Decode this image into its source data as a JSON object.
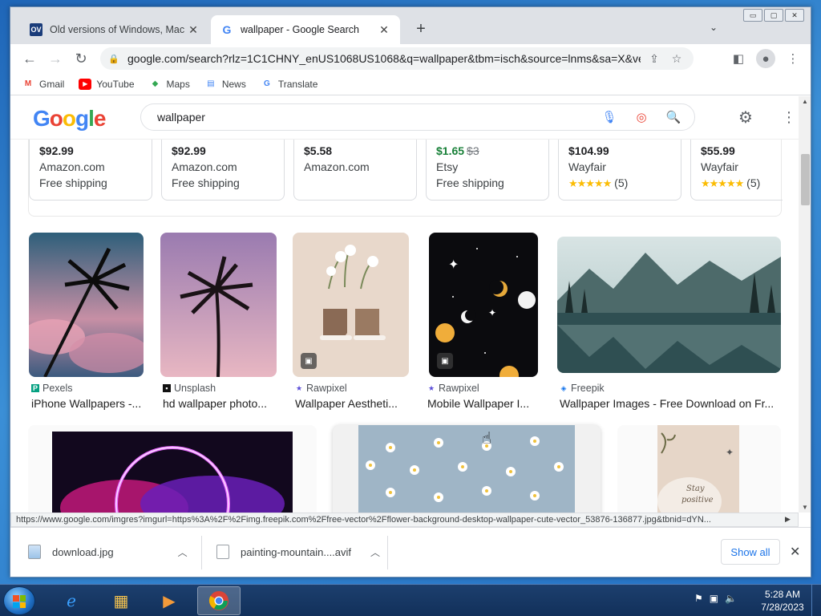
{
  "window": {
    "tabs": [
      {
        "title": "Old versions of Windows, Mac and",
        "favicon": "OV"
      },
      {
        "title": "wallpaper - Google Search",
        "favicon": "G"
      }
    ],
    "new_tab": "+",
    "controls": {
      "minimize": "▭",
      "maximize": "▢",
      "close": "✕"
    }
  },
  "toolbar": {
    "url": "google.com/search?rlz=1C1CHNY_enUS1068US1068&q=wallpaper&tbm=isch&source=lnms&sa=X&ved=2..."
  },
  "bookmarks": [
    {
      "label": "Gmail",
      "icon": "gmail-icon",
      "color": "#ea4335"
    },
    {
      "label": "YouTube",
      "icon": "youtube-icon",
      "color": "#ff0000"
    },
    {
      "label": "Maps",
      "icon": "maps-icon",
      "color": "#34a853"
    },
    {
      "label": "News",
      "icon": "news-icon",
      "color": "#4285f4"
    },
    {
      "label": "Translate",
      "icon": "translate-icon",
      "color": "#4285f4"
    }
  ],
  "google": {
    "logo": [
      "G",
      "o",
      "o",
      "g",
      "l",
      "e"
    ],
    "query": "wallpaper"
  },
  "shopping": [
    {
      "price": "$92.99",
      "store": "Amazon.com",
      "extra": "Free shipping"
    },
    {
      "price": "$92.99",
      "store": "Amazon.com",
      "extra": "Free shipping"
    },
    {
      "price": "$5.58",
      "store": "Amazon.com",
      "extra": ""
    },
    {
      "price": "$1.65",
      "old_price": "$3",
      "store": "Etsy",
      "extra": "Free shipping"
    },
    {
      "price": "$104.99",
      "store": "Wayfair",
      "stars": "★★★★★",
      "reviews": "(5)"
    },
    {
      "price": "$55.99",
      "store": "Wayfair",
      "stars": "★★★★★",
      "reviews": "(5)"
    }
  ],
  "images": [
    {
      "source": "Pexels",
      "caption": "iPhone Wallpapers -...",
      "src_color": "#05a081"
    },
    {
      "source": "Unsplash",
      "caption": "hd wallpaper photo...",
      "src_color": "#111111"
    },
    {
      "source": "Rawpixel",
      "caption": "Wallpaper Aestheti...",
      "src_color": "#5b4ed8"
    },
    {
      "source": "Rawpixel",
      "caption": "Mobile Wallpaper I...",
      "src_color": "#5b4ed8"
    },
    {
      "source": "Freepik",
      "caption": "Wallpaper Images - Free Download on Fr...",
      "src_color": "#1273eb"
    }
  ],
  "status_url": "https://www.google.com/imgres?imgurl=https%3A%2F%2Fimg.freepik.com%2Ffree-vector%2Fflower-background-desktop-wallpaper-cute-vector_53876-136877.jpg&tbnid=dYN...",
  "downloads": {
    "items": [
      {
        "name": "download.jpg"
      },
      {
        "name": "painting-mountain....avif"
      }
    ],
    "show_all": "Show all"
  },
  "taskbar": {
    "time": "5:28 AM",
    "date": "7/28/2023"
  }
}
